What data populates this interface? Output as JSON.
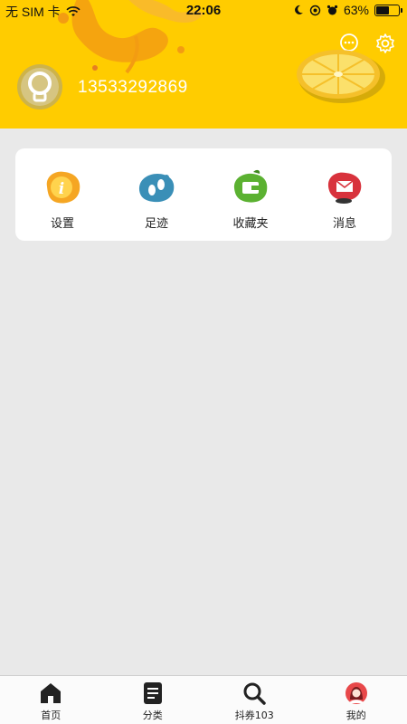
{
  "status_bar": {
    "carrier": "无 SIM 卡",
    "time": "22:06",
    "battery_percent": "63%",
    "battery_level": 0.63
  },
  "profile": {
    "phone": "13533292869"
  },
  "menu": {
    "items": [
      {
        "label": "设置",
        "icon": "info-icon",
        "color": "#f5a623"
      },
      {
        "label": "足迹",
        "icon": "footprint-icon",
        "color": "#3a8fb7"
      },
      {
        "label": "收藏夹",
        "icon": "wallet-icon",
        "color": "#5bb131"
      },
      {
        "label": "消息",
        "icon": "mail-icon",
        "color": "#d8323c"
      }
    ]
  },
  "tabbar": {
    "items": [
      {
        "label": "首页",
        "icon": "home-icon"
      },
      {
        "label": "分类",
        "icon": "list-icon"
      },
      {
        "label": "抖券103",
        "icon": "search-icon"
      },
      {
        "label": "我的",
        "icon": "profile-icon"
      }
    ]
  },
  "colors": {
    "header": "#ffcc00",
    "background": "#e9e9e9",
    "active_tab": "#e8484a"
  }
}
